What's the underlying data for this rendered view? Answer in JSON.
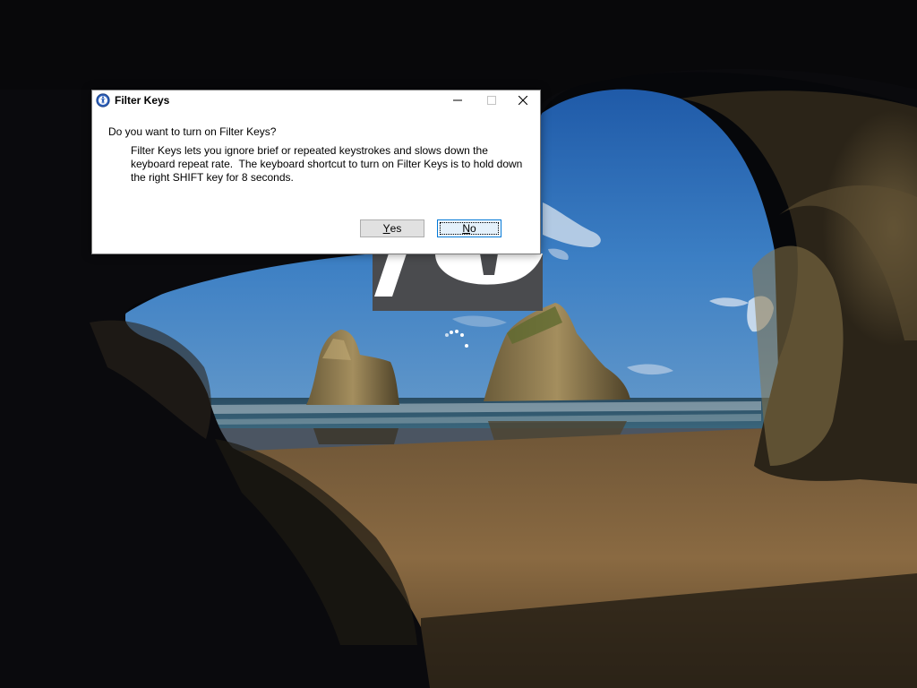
{
  "desktop": {
    "wallpaper": "cave-arch-beach",
    "loading_indicator": "spinning-dots"
  },
  "dialog": {
    "title": "Filter Keys",
    "icon": "ease-of-access-icon",
    "question": "Do you want to turn on Filter Keys?",
    "body_lines": [
      "Filter Keys lets you ignore brief or repeated keystrokes and slows down the",
      "keyboard repeat rate.  The keyboard shortcut to turn on Filter Keys is to hold down",
      "the right SHIFT key for 8 seconds."
    ],
    "buttons": {
      "yes": {
        "accel": "Y",
        "rest": "es"
      },
      "no": {
        "accel": "N",
        "rest": "o"
      }
    },
    "default_button": "no",
    "titlebar_icons": [
      "minimize-icon",
      "maximize-icon",
      "close-icon"
    ]
  },
  "colors": {
    "dialog_bg": "#ffffff",
    "button_bg": "#e1e1e1",
    "default_button_border": "#0078d7",
    "sky": "#2f6fbf",
    "sand": "#8a6a42"
  }
}
